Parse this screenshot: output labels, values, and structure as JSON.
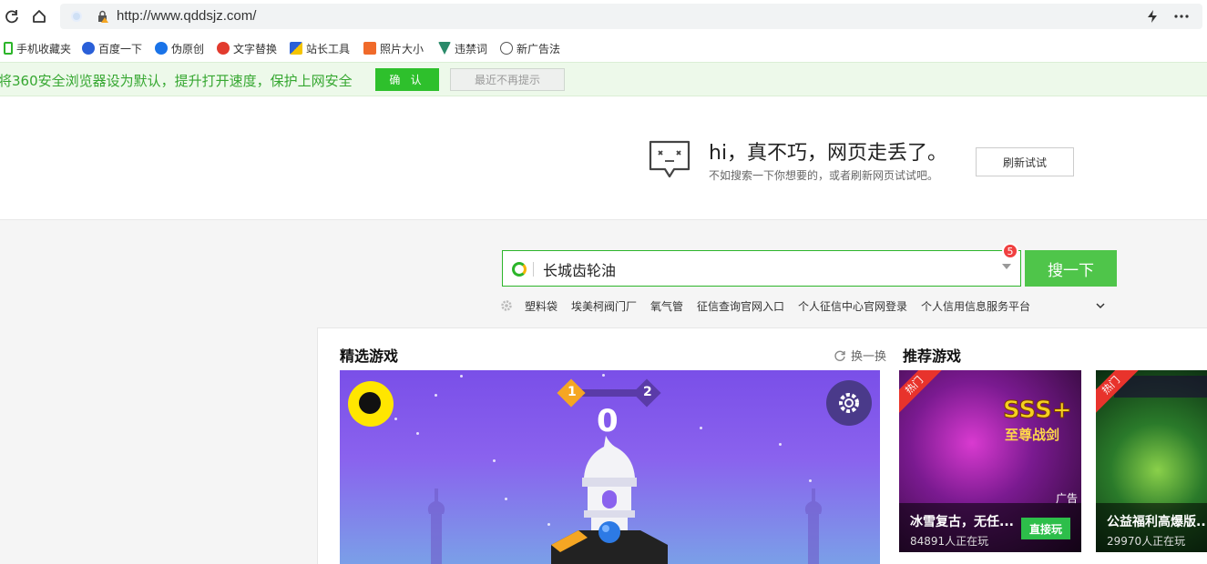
{
  "browser": {
    "url": "http://www.qddsjz.com/"
  },
  "bookmarks": [
    {
      "label": "手机收藏夹",
      "icon": "phone-icon",
      "color": "#2cb52a"
    },
    {
      "label": "百度一下",
      "icon": "baidu-paw-icon",
      "color": "#2a5fd8"
    },
    {
      "label": "伪原创",
      "icon": "swirl-icon",
      "color": "#1a73e8"
    },
    {
      "label": "文字替换",
      "icon": "badge-icon",
      "color": "#e23b2e"
    },
    {
      "label": "站长工具",
      "icon": "tool-icon",
      "color": "#2a5fd8"
    },
    {
      "label": "照片大小",
      "icon": "photo-icon",
      "color": "#f06a2a"
    },
    {
      "label": "违禁词",
      "icon": "shield-v-icon",
      "color": "#2a8a6a"
    },
    {
      "label": "新广告法",
      "icon": "globe-icon",
      "color": "#555555"
    }
  ],
  "notice": {
    "text": "将360安全浏览器设为默认，提升打开速度，保护上网安全",
    "confirm_label": "确 认",
    "later_label": "最近不再提示"
  },
  "error": {
    "title": "hi，真不巧，网页走丢了。",
    "subtitle": "不如搜索一下你想要的，或者刷新网页试试吧。",
    "refresh_label": "刷新试试"
  },
  "search": {
    "query": "长城齿轮油",
    "badge_count": "5",
    "button_label": "搜一下",
    "hot_terms": [
      "塑料袋",
      "埃美柯阀门厂",
      "氧气管",
      "征信查询官网入口",
      "个人征信中心官网登录",
      "个人信用信息服务平台"
    ]
  },
  "games": {
    "featured_title": "精选游戏",
    "swap_label": "换一换",
    "recommended_title": "推荐游戏",
    "featured_game": {
      "level_current": "1",
      "level_next": "2",
      "score": "0"
    },
    "recommended": [
      {
        "hot_label": "热门",
        "name": "冰雪复古，无任...",
        "players": "84891人正在玩",
        "play_label": "直接玩",
        "ad_label": "广告"
      },
      {
        "hot_label": "热门",
        "name": "公益福利高爆版...",
        "players": "29970人正在玩"
      }
    ]
  },
  "colors": {
    "accent_green": "#2ec02c",
    "search_green": "#4fc54a",
    "badge_red": "#f04040"
  }
}
